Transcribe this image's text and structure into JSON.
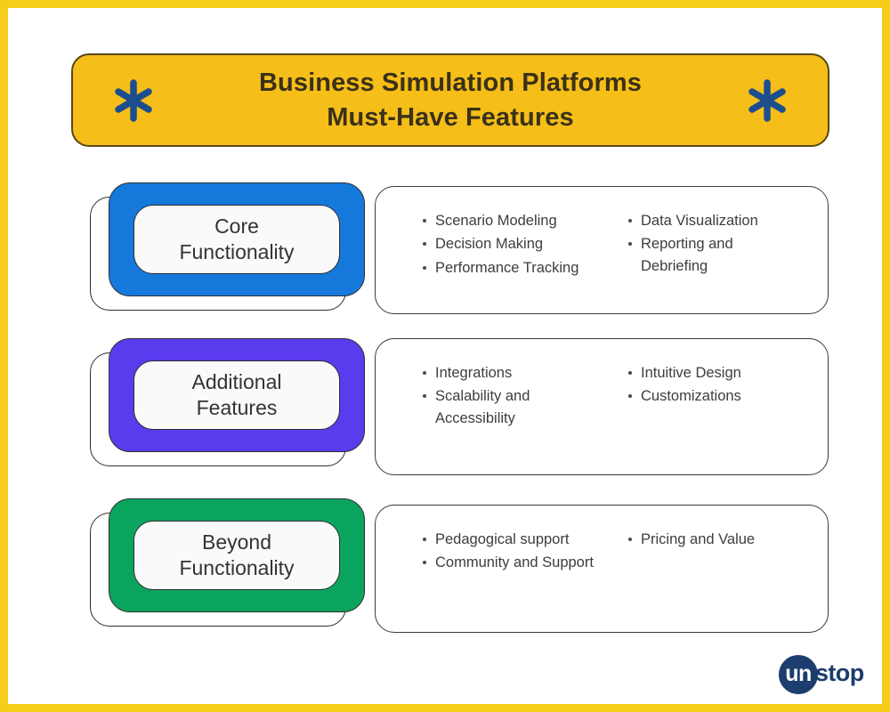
{
  "header": {
    "title": "Business Simulation Platforms\nMust-Have Features",
    "left_icon": "asterisk-icon",
    "right_icon": "asterisk-icon",
    "background_color": "#F5BE18",
    "text_color": "#3a3118",
    "icon_color": "#1C4E8E"
  },
  "frame": {
    "border_color": "#F5CE1C",
    "background_color": "#FFFFFF"
  },
  "sections": [
    {
      "label": "Core\nFunctionality",
      "color": "#1579DC",
      "color_name": "blue",
      "columns": [
        [
          "Scenario Modeling",
          "Decision Making",
          "Performance Tracking"
        ],
        [
          "Data Visualization",
          "Reporting and Debriefing"
        ]
      ]
    },
    {
      "label": "Additional\nFeatures",
      "color": "#5B3BEE",
      "color_name": "purple",
      "columns": [
        [
          "Integrations",
          "Scalability and Accessibility"
        ],
        [
          "Intuitive Design",
          "Customizations"
        ]
      ]
    },
    {
      "label": "Beyond\nFunctionality",
      "color": "#0BA45F",
      "color_name": "green",
      "columns": [
        [
          "Pedagogical support",
          "Community and Support"
        ],
        [
          "Pricing and Value"
        ]
      ]
    }
  ],
  "logo": {
    "mark_text": "un",
    "word_text": "stop",
    "color": "#1C3D6E"
  }
}
